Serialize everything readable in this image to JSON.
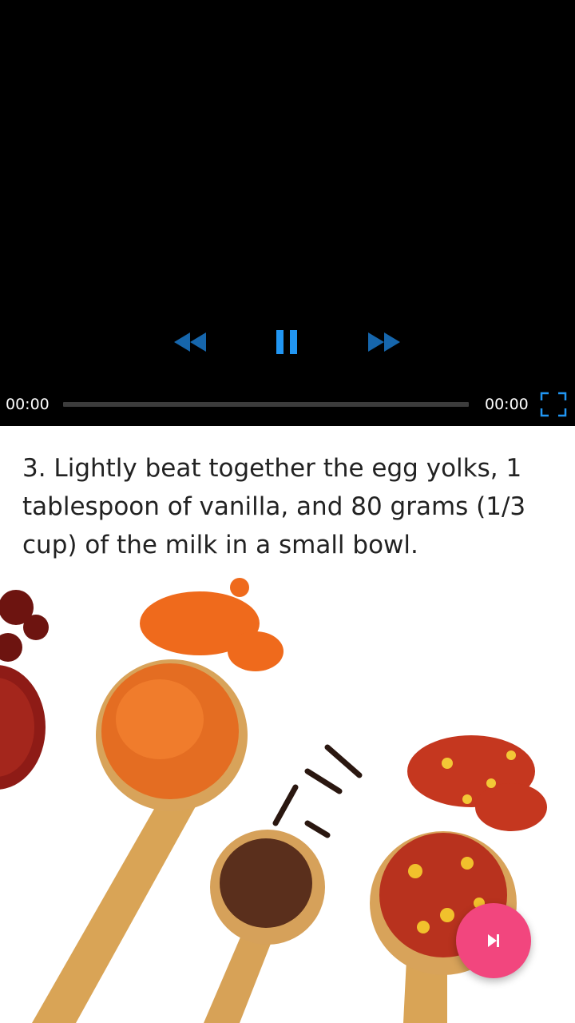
{
  "player": {
    "time_current": "00:00",
    "time_total": "00:00",
    "progress": 0,
    "controls": {
      "rewind_icon": "rewind-icon",
      "pause_icon": "pause-icon",
      "forward_icon": "fast-forward-icon",
      "fullscreen_icon": "fullscreen-icon"
    },
    "colors": {
      "accent": "#2196f3",
      "background": "#000000"
    }
  },
  "step": {
    "text": "3. Lightly beat together the egg yolks, 1 tablespoon of vanilla, and 80 grams (1/3 cup) of the milk in a small bowl."
  },
  "fab": {
    "icon": "skip-next-icon",
    "color": "#f2467e"
  }
}
